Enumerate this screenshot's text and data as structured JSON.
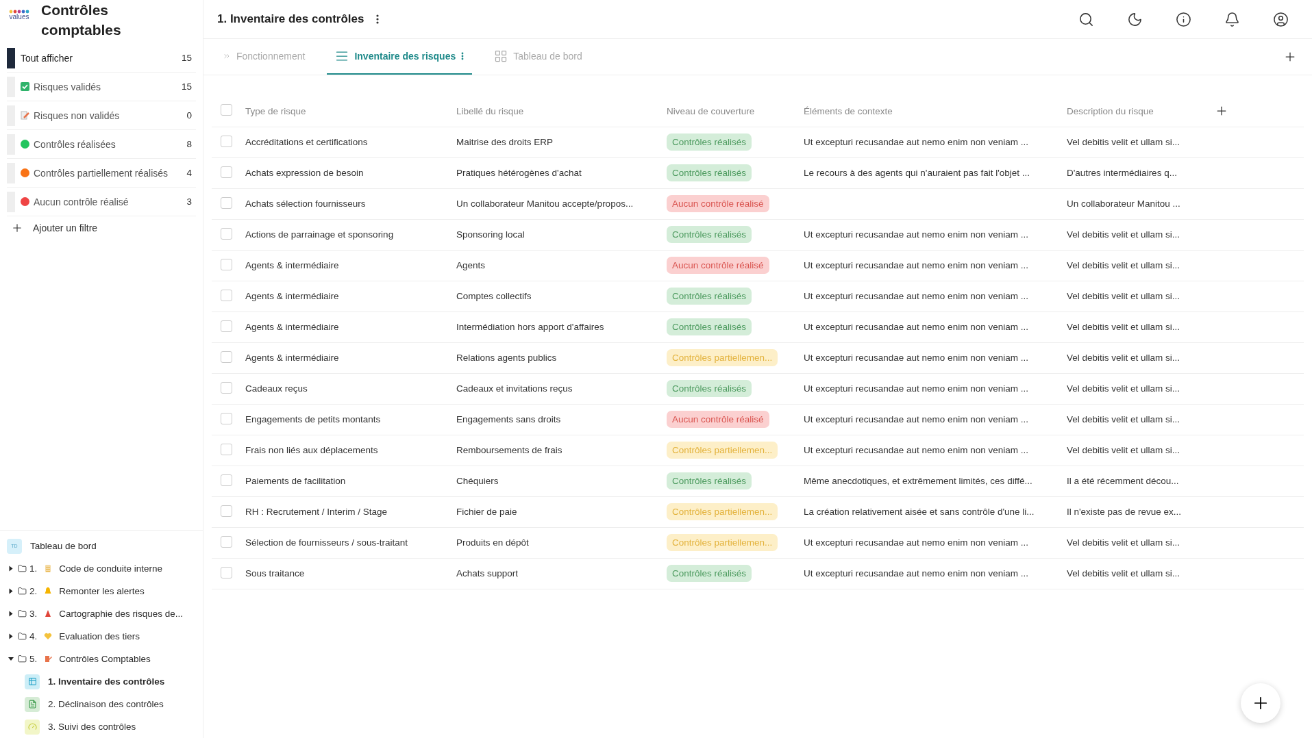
{
  "sidebar": {
    "logo": "values",
    "title": "Contrôles comptables",
    "filters": [
      {
        "kind": "all",
        "label": "Tout afficher",
        "count": "15",
        "selected": true
      },
      {
        "kind": "check",
        "label": "Risques validés",
        "count": "15",
        "selected": false
      },
      {
        "kind": "edit",
        "label": "Risques non validés",
        "count": "0",
        "selected": false
      },
      {
        "kind": "dot",
        "label": "Contrôles réalisées",
        "count": "8",
        "selected": false,
        "color": "#22c55e"
      },
      {
        "kind": "dot",
        "label": "Contrôles partiellement réalisés",
        "count": "4",
        "selected": false,
        "color": "#f97316"
      },
      {
        "kind": "dot",
        "label": "Aucun contrôle réalisé",
        "count": "3",
        "selected": false,
        "color": "#ef4444"
      }
    ],
    "add_filter": "Ajouter un filtre",
    "dashboard": {
      "badge": "TD",
      "label": "Tableau de bord"
    },
    "tree": [
      {
        "number": "1.",
        "kind": "scroll",
        "label": "Code de conduite interne",
        "expanded": false
      },
      {
        "number": "2.",
        "kind": "bell",
        "label": "Remonter les alertes",
        "expanded": false
      },
      {
        "number": "3.",
        "kind": "cone",
        "label": "Cartographie des risques de...",
        "expanded": false
      },
      {
        "number": "4.",
        "kind": "heart",
        "label": "Evaluation des tiers",
        "expanded": false
      },
      {
        "number": "5.",
        "kind": "edit",
        "label": "Contrôles Comptables",
        "expanded": true,
        "children": [
          {
            "kind": "table",
            "label": "1. Inventaire des contrôles",
            "selected": true
          },
          {
            "kind": "doc",
            "label": "2. Déclinaison des contrôles",
            "selected": false
          },
          {
            "kind": "gauge",
            "label": "3. Suivi des contrôles",
            "selected": false
          }
        ]
      }
    ]
  },
  "header": {
    "title": "1. Inventaire des contrôles"
  },
  "tabs": [
    {
      "kind": "flow",
      "label": "Fonctionnement",
      "selected": false
    },
    {
      "kind": "list",
      "label": "Inventaire des risques",
      "selected": true
    },
    {
      "kind": "grid",
      "label": "Tableau de bord",
      "selected": false
    }
  ],
  "table": {
    "all_checked": false,
    "columns": [
      "Type de risque",
      "Libellé du risque",
      "Niveau de couverture",
      "Éléments de contexte",
      "Description du risque"
    ],
    "rows": [
      {
        "checked": false,
        "type": "Accréditations et certifications",
        "label": "Maitrise des droits ERP",
        "status": {
          "kind": "done",
          "text": "Contrôles réalisés"
        },
        "context": "Ut excepturi recusandae aut nemo enim non veniam ...",
        "description": "Vel debitis velit et ullam si..."
      },
      {
        "checked": false,
        "type": "Achats expression de besoin",
        "label": "Pratiques hétérogènes d'achat",
        "status": {
          "kind": "done",
          "text": "Contrôles réalisés"
        },
        "context": "Le recours à des agents qui n'auraient pas fait l'objet ...",
        "description": "D'autres intermédiaires q..."
      },
      {
        "checked": false,
        "type": "Achats sélection fournisseurs",
        "label": "Un collaborateur Manitou accepte/propos...",
        "status": {
          "kind": "none",
          "text": "Aucun contrôle réalisé"
        },
        "description": "Un collaborateur Manitou ..."
      },
      {
        "checked": false,
        "type": "Actions de parrainage et sponsoring",
        "label": "Sponsoring local",
        "status": {
          "kind": "done",
          "text": "Contrôles réalisés"
        },
        "context": "Ut excepturi recusandae aut nemo enim non veniam ...",
        "description": "Vel debitis velit et ullam si..."
      },
      {
        "checked": false,
        "type": "Agents & intermédiaire",
        "label": "Agents",
        "status": {
          "kind": "none",
          "text": "Aucun contrôle réalisé"
        },
        "context": "Ut excepturi recusandae aut nemo enim non veniam ...",
        "description": "Vel debitis velit et ullam si..."
      },
      {
        "checked": false,
        "type": "Agents & intermédiaire",
        "label": "Comptes collectifs",
        "status": {
          "kind": "done",
          "text": "Contrôles réalisés"
        },
        "context": "Ut excepturi recusandae aut nemo enim non veniam ...",
        "description": "Vel debitis velit et ullam si..."
      },
      {
        "checked": false,
        "type": "Agents & intermédiaire",
        "label": "Intermédiation hors apport d'affaires",
        "status": {
          "kind": "done",
          "text": "Contrôles réalisés"
        },
        "context": "Ut excepturi recusandae aut nemo enim non veniam ...",
        "description": "Vel debitis velit et ullam si..."
      },
      {
        "checked": false,
        "type": "Agents & intermédiaire",
        "label": "Relations agents publics",
        "status": {
          "kind": "partial",
          "text": "Contrôles partiellemen..."
        },
        "context": "Ut excepturi recusandae aut nemo enim non veniam ...",
        "description": "Vel debitis velit et ullam si..."
      },
      {
        "checked": false,
        "type": "Cadeaux reçus",
        "label": "Cadeaux et invitations reçus",
        "status": {
          "kind": "done",
          "text": "Contrôles réalisés"
        },
        "context": "Ut excepturi recusandae aut nemo enim non veniam ...",
        "description": "Vel debitis velit et ullam si..."
      },
      {
        "checked": false,
        "type": "Engagements de petits montants",
        "label": "Engagements sans droits",
        "status": {
          "kind": "none",
          "text": "Aucun contrôle réalisé"
        },
        "context": "Ut excepturi recusandae aut nemo enim non veniam ...",
        "description": "Vel debitis velit et ullam si..."
      },
      {
        "checked": false,
        "type": "Frais non liés aux déplacements",
        "label": "Remboursements de frais",
        "status": {
          "kind": "partial",
          "text": "Contrôles partiellemen..."
        },
        "context": "Ut excepturi recusandae aut nemo enim non veniam ...",
        "description": "Vel debitis velit et ullam si..."
      },
      {
        "checked": false,
        "type": "Paiements de facilitation",
        "label": "Chéquiers",
        "status": {
          "kind": "done",
          "text": "Contrôles réalisés"
        },
        "context": "Même anecdotiques, et extrêmement limités, ces diffé...",
        "description": "Il a été récemment décou..."
      },
      {
        "checked": false,
        "type": "RH : Recrutement / Interim / Stage",
        "label": "Fichier de paie",
        "status": {
          "kind": "partial",
          "text": "Contrôles partiellemen..."
        },
        "context": "La création relativement aisée et sans contrôle d'une li...",
        "description": "Il n'existe pas de revue ex..."
      },
      {
        "checked": false,
        "type": "Sélection de fournisseurs / sous-traitant",
        "label": "Produits en dépôt",
        "status": {
          "kind": "partial",
          "text": "Contrôles partiellemen..."
        },
        "context": "Ut excepturi recusandae aut nemo enim non veniam ...",
        "description": "Vel debitis velit et ullam si..."
      },
      {
        "checked": false,
        "type": "Sous traitance",
        "label": "Achats support",
        "status": {
          "kind": "done",
          "text": "Contrôles réalisés"
        },
        "context": "Ut excepturi recusandae aut nemo enim non veniam ...",
        "description": "Vel debitis velit et ullam si..."
      }
    ]
  }
}
